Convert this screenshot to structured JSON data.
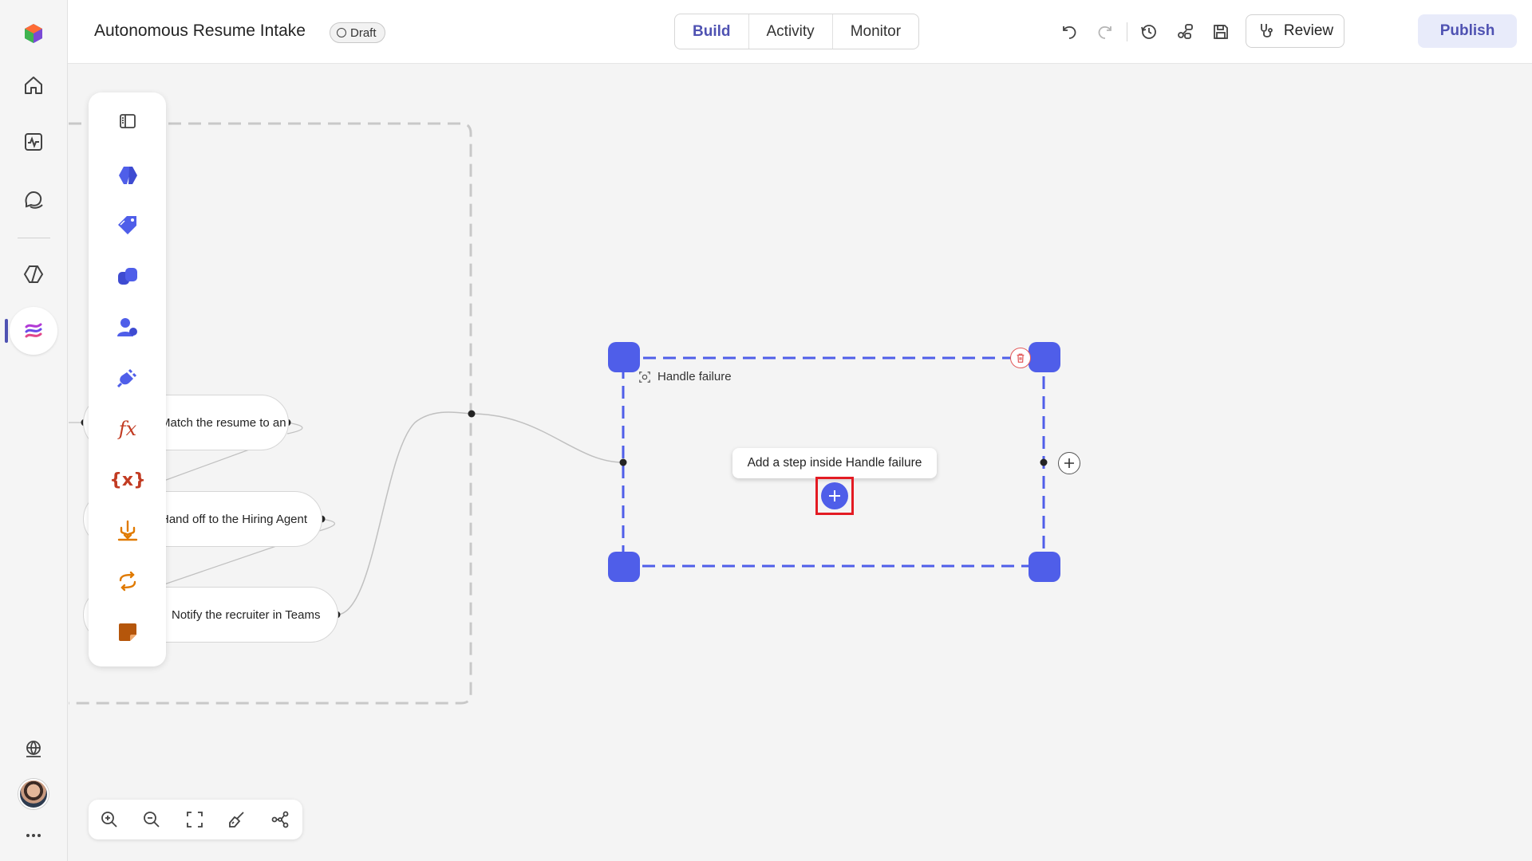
{
  "app": {
    "title": "Autonomous Resume Intake",
    "status": "Draft"
  },
  "tabs": [
    {
      "label": "Build",
      "active": true
    },
    {
      "label": "Activity",
      "active": false
    },
    {
      "label": "Monitor",
      "active": false
    }
  ],
  "toolbar": {
    "review_label": "Review",
    "publish_label": "Publish",
    "icons": [
      "undo-icon",
      "redo-icon",
      "history-icon",
      "connections-icon",
      "save-icon",
      "run-icon",
      "more-icon"
    ]
  },
  "rail": {
    "items": [
      "home-icon",
      "activity-icon",
      "chat-icon",
      "agents-icon",
      "flows-icon"
    ],
    "active": "flows-icon",
    "bottom": [
      "environment-icon",
      "avatar",
      "more-icon"
    ]
  },
  "toolbox": {
    "items": [
      "collapse-panel-icon",
      "agent-icon",
      "tag-icon",
      "copilot-icon",
      "human-icon",
      "connector-icon",
      "formula-icon",
      "variable-icon",
      "condition-icon",
      "loop-icon",
      "note-icon"
    ]
  },
  "nodes": [
    {
      "label": "Match the resume to an open role"
    },
    {
      "label": "Hand off to the Hiring Agent"
    },
    {
      "label": "Notify the recruiter in Teams"
    }
  ],
  "group": {
    "label": "Handle failure",
    "tooltip": "Add a step inside Handle failure"
  },
  "zoom_controls": [
    "zoom-in-icon",
    "zoom-out-icon",
    "fit-view-icon",
    "clean-up-icon",
    "layout-icon"
  ],
  "colors": {
    "accent": "#4f52b2",
    "selection": "#4f5ee9",
    "highlight": "#e31b23",
    "publish_bg": "#e8ebfa"
  }
}
